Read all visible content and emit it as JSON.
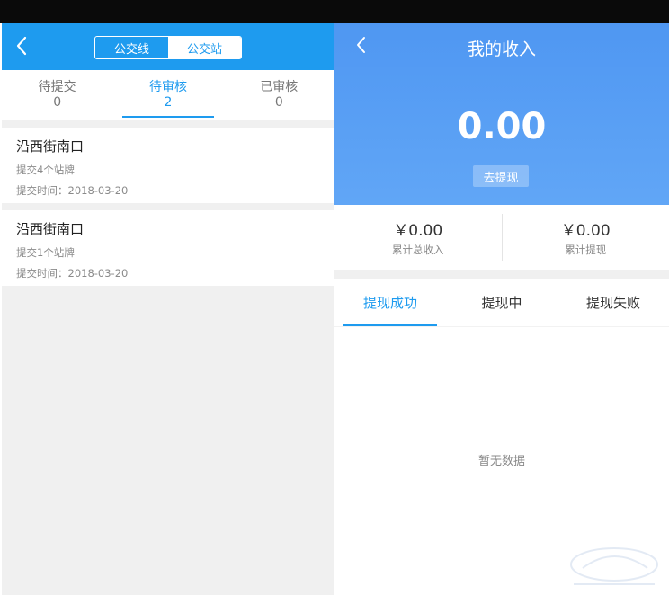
{
  "colors": {
    "brand_blue": "#1e9bef",
    "hero_blue": "#5aa1f4",
    "background_gray": "#f0f0f0"
  },
  "left": {
    "segmented": {
      "items": [
        "公交线",
        "公交站"
      ],
      "active_index": 1
    },
    "tabs": [
      {
        "label": "待提交",
        "count": "0"
      },
      {
        "label": "待审核",
        "count": "2"
      },
      {
        "label": "已审核",
        "count": "0"
      }
    ],
    "active_tab": 1,
    "cards": [
      {
        "title": "沿西街南口",
        "desc": "提交4个站牌",
        "time": "提交时间：2018-03-20"
      },
      {
        "title": "沿西街南口",
        "desc": "提交1个站牌",
        "time": "提交时间：2018-03-20"
      }
    ]
  },
  "right": {
    "title": "我的收入",
    "amount": "0.00",
    "withdraw_button": "去提现",
    "stats": [
      {
        "value": "￥0.00",
        "label": "累计总收入"
      },
      {
        "value": "￥0.00",
        "label": "累计提现"
      }
    ],
    "tabs": [
      "提现成功",
      "提现中",
      "提现失败"
    ],
    "active_tab": 0,
    "empty_text": "暂无数据"
  },
  "icons": {
    "back": "chevron-left-icon"
  }
}
